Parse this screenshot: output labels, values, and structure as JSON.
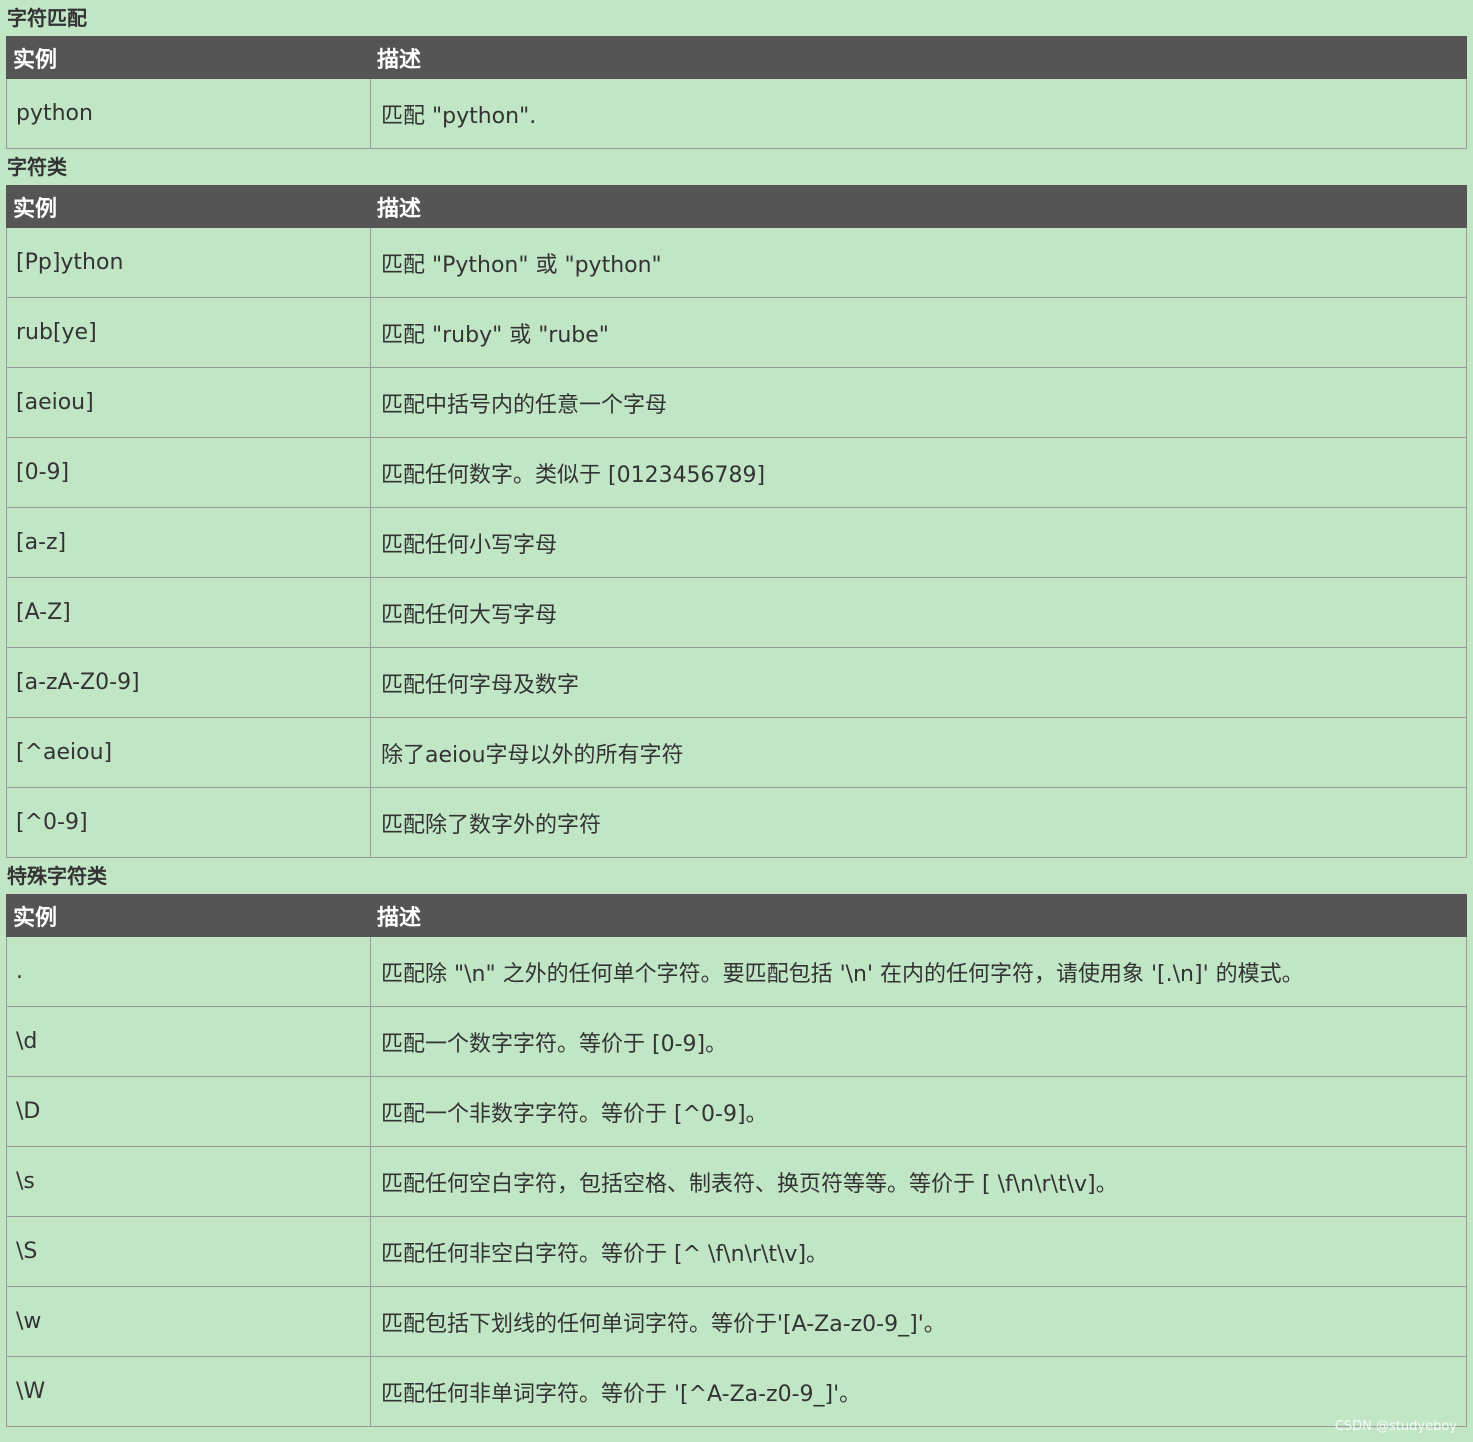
{
  "sections": [
    {
      "title": "字符匹配",
      "headers": [
        "实例",
        "描述"
      ],
      "rows": [
        [
          "python",
          "匹配 \"python\"."
        ]
      ]
    },
    {
      "title": "字符类",
      "headers": [
        "实例",
        "描述"
      ],
      "rows": [
        [
          "[Pp]ython",
          "匹配 \"Python\" 或 \"python\""
        ],
        [
          "rub[ye]",
          "匹配 \"ruby\" 或 \"rube\""
        ],
        [
          "[aeiou]",
          "匹配中括号内的任意一个字母"
        ],
        [
          "[0-9]",
          "匹配任何数字。类似于 [0123456789]"
        ],
        [
          "[a-z]",
          "匹配任何小写字母"
        ],
        [
          "[A-Z]",
          "匹配任何大写字母"
        ],
        [
          "[a-zA-Z0-9]",
          "匹配任何字母及数字"
        ],
        [
          "[^aeiou]",
          "除了aeiou字母以外的所有字符"
        ],
        [
          "[^0-9]",
          "匹配除了数字外的字符"
        ]
      ]
    },
    {
      "title": "特殊字符类",
      "headers": [
        "实例",
        "描述"
      ],
      "rows": [
        [
          ".",
          "匹配除 \"\\n\" 之外的任何单个字符。要匹配包括 '\\n' 在内的任何字符，请使用象 '[.\\n]' 的模式。"
        ],
        [
          "\\d",
          "匹配一个数字字符。等价于 [0-9]。"
        ],
        [
          "\\D",
          "匹配一个非数字字符。等价于 [^0-9]。"
        ],
        [
          "\\s",
          "匹配任何空白字符，包括空格、制表符、换页符等等。等价于 [ \\f\\n\\r\\t\\v]。"
        ],
        [
          "\\S",
          "匹配任何非空白字符。等价于 [^ \\f\\n\\r\\t\\v]。"
        ],
        [
          "\\w",
          "匹配包括下划线的任何单词字符。等价于'[A-Za-z0-9_]'。"
        ],
        [
          "\\W",
          "匹配任何非单词字符。等价于 '[^A-Za-z0-9_]'。"
        ]
      ]
    }
  ],
  "watermark": "CSDN @studyeboy",
  "colors": {
    "background": "#c1e6c6",
    "header_bg": "#555555",
    "header_text": "#ffffff",
    "border": "#999999",
    "text": "#333333"
  }
}
